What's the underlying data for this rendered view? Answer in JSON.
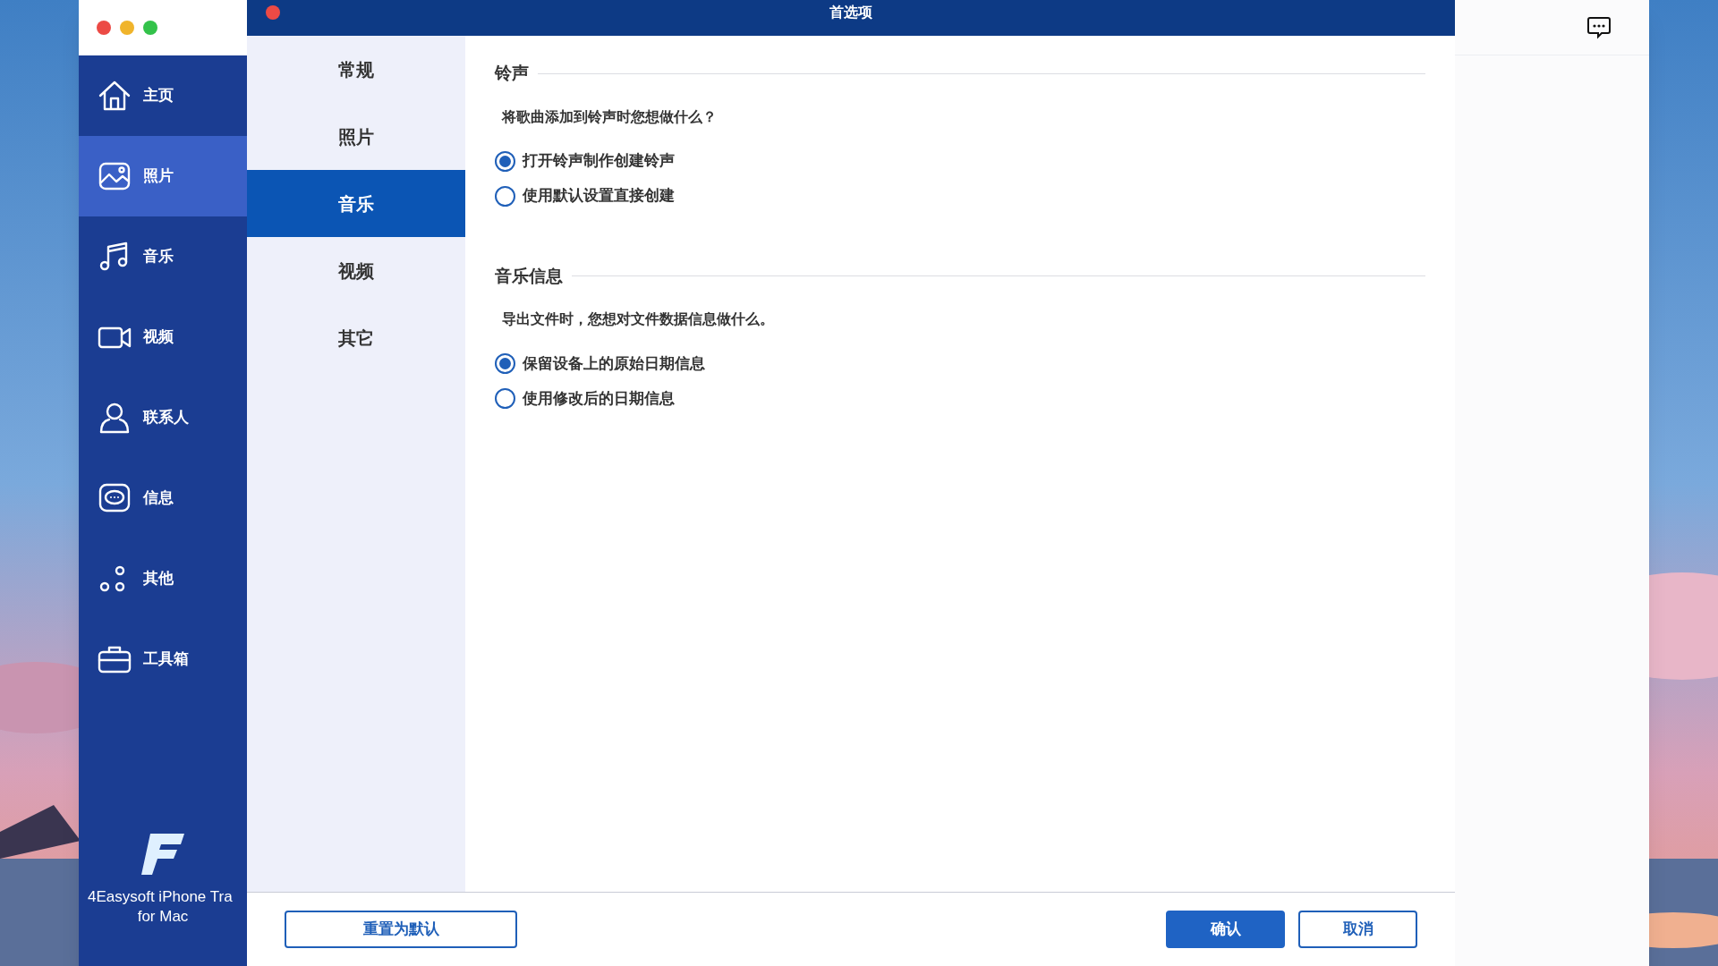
{
  "app": {
    "nav": [
      {
        "kind": "home",
        "label": "主页",
        "selected": false
      },
      {
        "label": "照片",
        "selected": true
      },
      {
        "kind": "music",
        "label": "音乐",
        "selected": false
      },
      {
        "kind": "video",
        "label": "视频",
        "selected": false
      },
      {
        "kind": "contact",
        "label": "联系人",
        "selected": false
      },
      {
        "kind": "message",
        "label": "信息",
        "selected": false
      },
      {
        "kind": "other",
        "label": "其他",
        "selected": false
      },
      {
        "kind": "toolbox",
        "label": "工具箱",
        "selected": false
      }
    ],
    "brand": {
      "line_1": "4Easysoft iPhone Tra",
      "line_2": "for Mac"
    }
  },
  "dialog": {
    "title": "首选项",
    "tabs": [
      {
        "label": "常规",
        "selected": false
      },
      {
        "label": "照片",
        "selected": false
      },
      {
        "label": "音乐",
        "selected": true
      },
      {
        "label": "视频",
        "selected": false
      },
      {
        "label": "其它",
        "selected": false
      }
    ],
    "sections": [
      {
        "heading": "铃声",
        "question": "将歌曲添加到铃声时您想做什么？",
        "options": [
          {
            "label": "打开铃声制作创建铃声",
            "selected": true
          },
          {
            "label": "使用默认设置直接创建",
            "selected": false
          }
        ]
      },
      {
        "heading": "音乐信息",
        "question": "导出文件时，您想对文件数据信息做什么。",
        "options": [
          {
            "label": "保留设备上的原始日期信息",
            "selected": true
          },
          {
            "label": "使用修改后的日期信息",
            "selected": false
          }
        ]
      }
    ],
    "buttons": [
      {
        "kind": "outline",
        "label": "重置为默认"
      },
      {
        "kind": "primary",
        "label": "确认"
      },
      {
        "kind": "outline",
        "label": "取消"
      }
    ]
  }
}
